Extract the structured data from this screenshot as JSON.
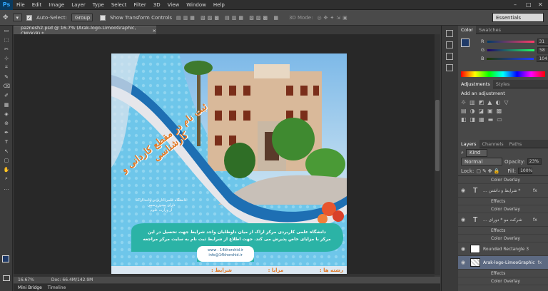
{
  "app": {
    "logo": "Ps"
  },
  "menu": [
    "File",
    "Edit",
    "Image",
    "Layer",
    "Type",
    "Select",
    "Filter",
    "3D",
    "View",
    "Window",
    "Help"
  ],
  "window_controls": [
    "–",
    "□",
    "✕"
  ],
  "options": {
    "auto_select_label": "Auto-Select:",
    "auto_select_value": "Group",
    "transform_label": "Show Transform Controls",
    "mode_label": "3D Mode:",
    "workspace": "Essentials"
  },
  "tools": [
    "▭",
    "⬚",
    "✂",
    "⊹",
    "⌗",
    "✎",
    "⌫",
    "✐",
    "▦",
    "◈",
    "⊚",
    "✒",
    "T",
    "↖",
    "▢",
    "✋",
    "⌕",
    "…"
  ],
  "document": {
    "tab_title": "paznesh2.psd @ 16.7% (Arak-logo-LimooGraphic, CMYK/8) *",
    "close": "×",
    "zoom": "16.67%",
    "doc_info": "Doc: 66.4M/142.9M"
  },
  "bottom_tabs": [
    "Mini Bridge",
    "Timeline"
  ],
  "color_panel": {
    "tabs": [
      "Color",
      "Swatches"
    ],
    "r_label": "R",
    "g_label": "G",
    "b_label": "B",
    "r": "31",
    "g": "58",
    "b": "104"
  },
  "adjustments_panel": {
    "tabs": [
      "Adjustments",
      "Styles"
    ],
    "title": "Add an adjustment"
  },
  "layers_panel": {
    "tabs": [
      "Layers",
      "Channels",
      "Paths"
    ],
    "kind": "Kind",
    "blend": "Normal",
    "opacity_label": "Opacity:",
    "opacity": "23%",
    "lock_label": "Lock:",
    "fill_label": "Fill:",
    "fill": "100%",
    "rows": [
      {
        "kind": "sub",
        "label": "Color Overlay"
      },
      {
        "kind": "text",
        "label": "... شرایط و داشتن *",
        "fx": "fx"
      },
      {
        "kind": "sub",
        "label": "Effects"
      },
      {
        "kind": "sub",
        "label": "Color Overlay"
      },
      {
        "kind": "text",
        "label": "... شرکت مو * دورای",
        "fx": "fx"
      },
      {
        "kind": "sub",
        "label": "Effects"
      },
      {
        "kind": "sub",
        "label": "Color Overlay"
      },
      {
        "kind": "thumb",
        "label": "Rounded Rectangle 3",
        "fx": ""
      },
      {
        "kind": "selected",
        "label": "Arak-logo-LimooGraphic",
        "fx": "fx"
      },
      {
        "kind": "sub",
        "label": "Effects"
      },
      {
        "kind": "sub",
        "label": "Color Overlay"
      }
    ]
  },
  "poster": {
    "headline": "ثبت نام در مقطع کاردانی و کارشناسی",
    "sub_lines": [
      "دانشگاه علمی کاربردی واحد اراک",
      "دارای مجوز رسمی",
      "از وزارت علوم"
    ],
    "body_line1": "دانشگاه علمی کاربردی مرکز اراک از میان داوطلبان واجد شرایط جهت تحصیل در این",
    "body_line2": "مرکز با مزایای خاص پذیرش می کند. جهت اطلاع از شرایط ثبت نام به سایت مرکز مراجعه",
    "web": "www . 14khorshid.ir",
    "email": "info@14khorshid.ir",
    "bottom_labels": [
      "رشته ها :",
      "مزایا :",
      "شرایط :"
    ]
  }
}
